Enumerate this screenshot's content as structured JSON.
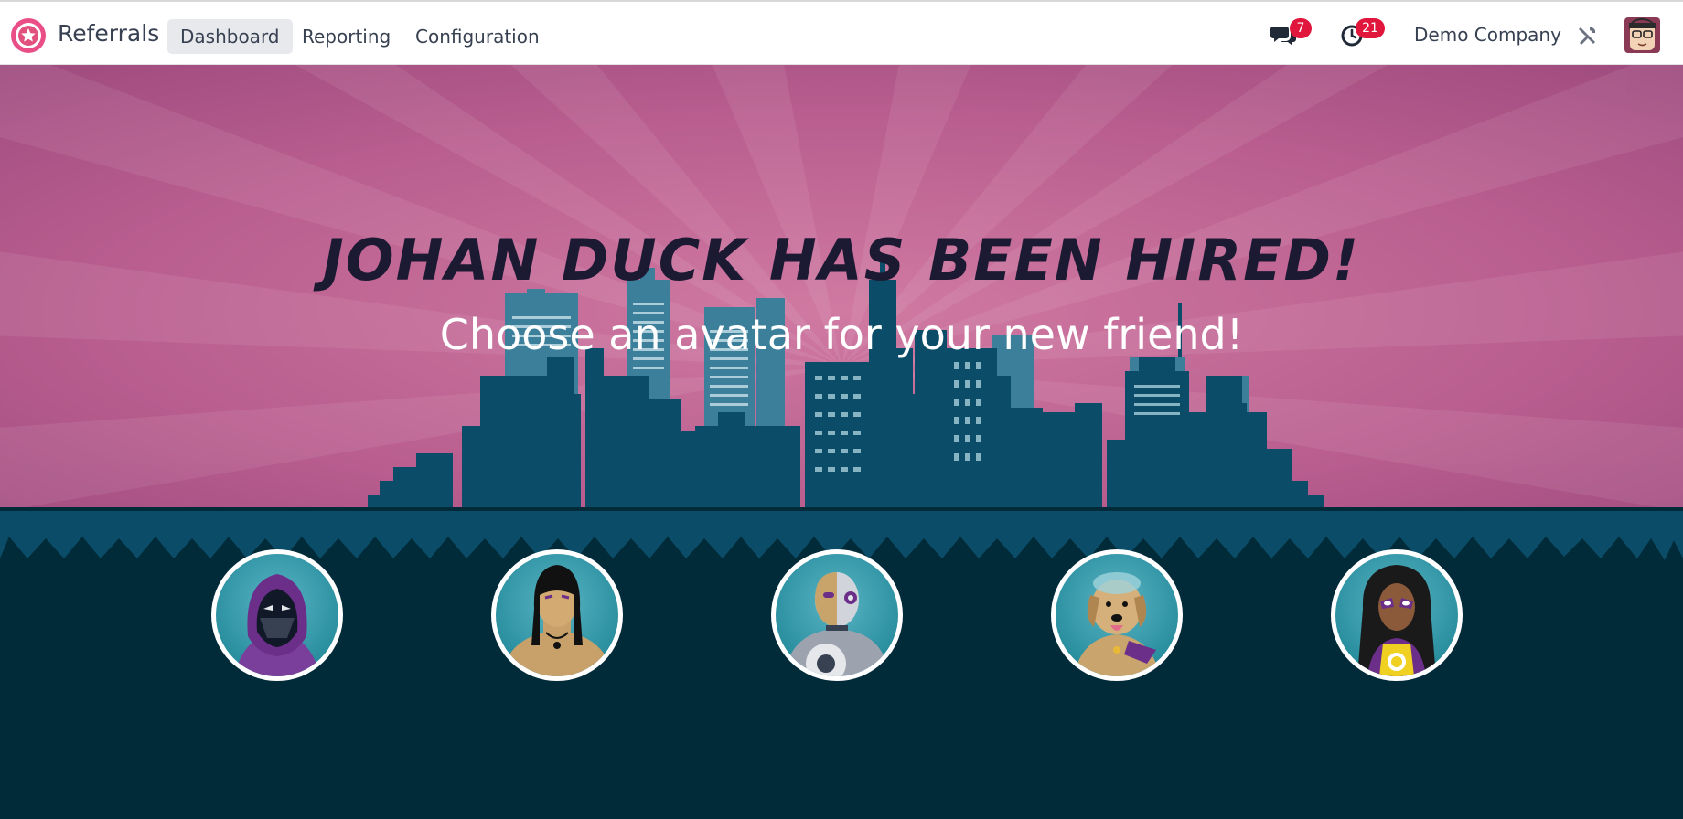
{
  "app": {
    "name": "Referrals",
    "logo_icon": "referrals-logo-icon"
  },
  "nav": {
    "items": [
      {
        "label": "Dashboard",
        "active": true
      },
      {
        "label": "Reporting",
        "active": false
      },
      {
        "label": "Configuration",
        "active": false
      }
    ]
  },
  "systray": {
    "messages_badge": "7",
    "activities_badge": "21",
    "company": "Demo Company",
    "icons": [
      "chat-icon",
      "clock-icon",
      "tools-icon",
      "user-avatar"
    ]
  },
  "banner": {
    "headline": "Johan Duck has been hired!",
    "subheadline": "Choose an avatar for your new friend!"
  },
  "avatars": [
    {
      "name": "hooded-ninja-avatar"
    },
    {
      "name": "long-hair-warrior-avatar"
    },
    {
      "name": "cyborg-avatar"
    },
    {
      "name": "dog-hero-avatar"
    },
    {
      "name": "masked-heroine-avatar"
    }
  ],
  "colors": {
    "sky": "#b55f8d",
    "city": "#0b4d68",
    "ground": "#022b3a",
    "headline": "#1c1a33",
    "badge": "#e0163c"
  }
}
